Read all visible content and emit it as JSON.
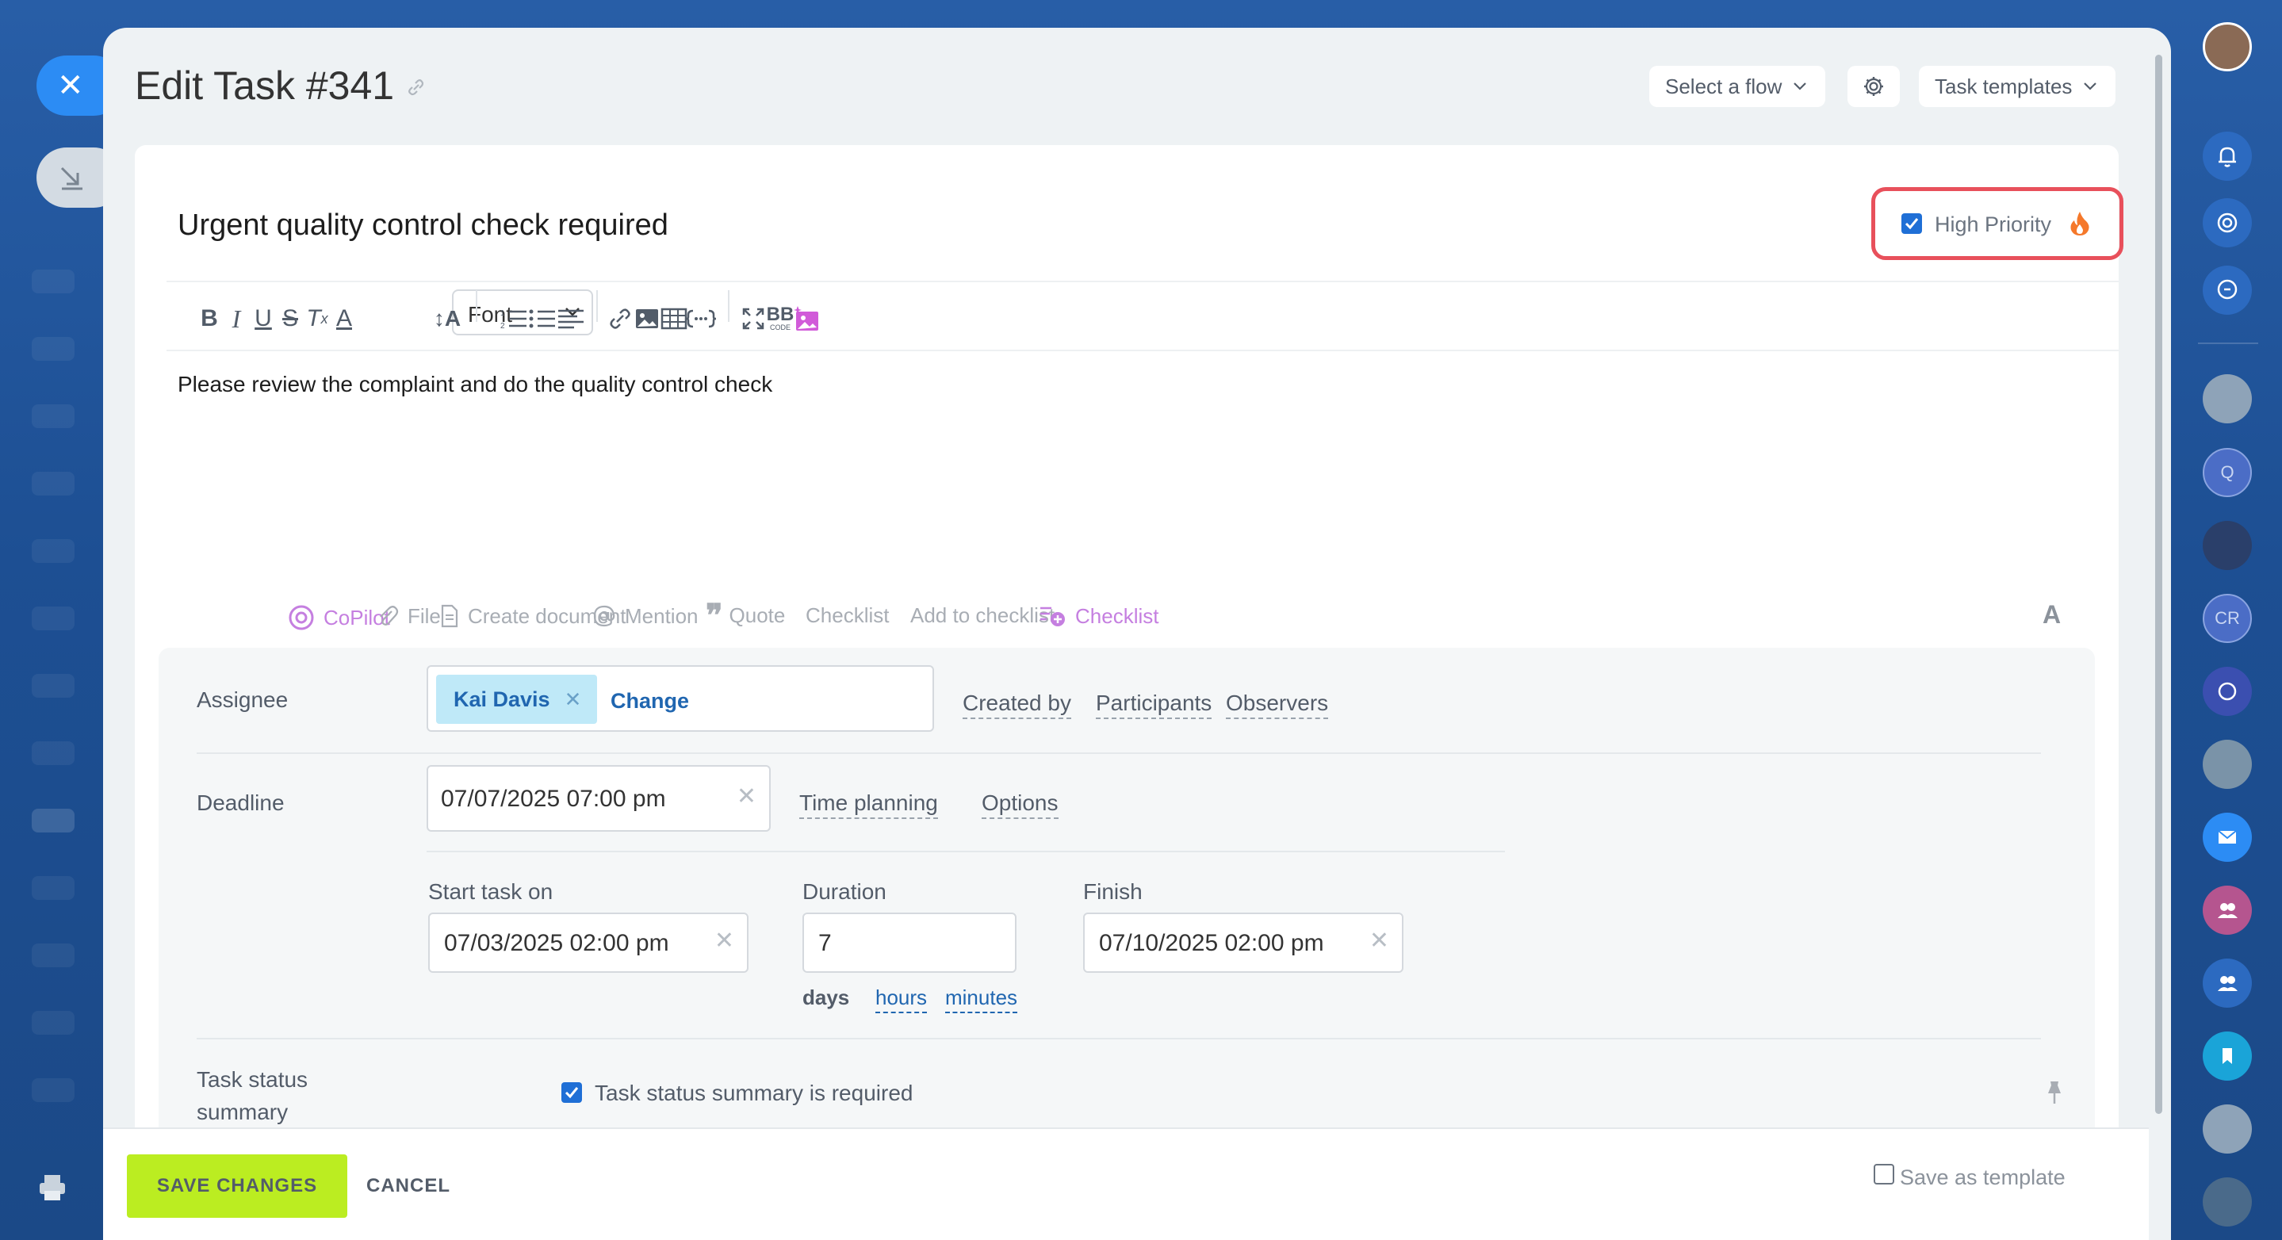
{
  "header": {
    "title": "Edit Task #341",
    "select_flow": "Select a flow",
    "task_templates": "Task templates"
  },
  "task": {
    "title": "Urgent quality control check required",
    "high_priority_label": "High Priority",
    "high_priority_checked": true,
    "description": "Please review the complaint and do the quality control check"
  },
  "toolbar": {
    "font_label": "Font",
    "buttons": [
      "bold",
      "italic",
      "underline",
      "strikethrough",
      "clear-format",
      "font-color",
      "font-size",
      "numbered-list",
      "bulleted-list",
      "align",
      "link",
      "image",
      "table",
      "code",
      "fullscreen",
      "bbcode",
      "ai-image"
    ]
  },
  "editor_tabs": {
    "copilot": "CoPilot",
    "file": "File",
    "create_document": "Create document",
    "mention": "Mention",
    "quote": "Quote",
    "checklist": "Checklist",
    "add_to_checklist": "Add to checklist",
    "checklist2": "Checklist",
    "format": "A"
  },
  "form": {
    "assignee_label": "Assignee",
    "assignee_name": "Kai Davis",
    "change": "Change",
    "created_by": "Created by",
    "participants": "Participants",
    "observers": "Observers",
    "deadline_label": "Deadline",
    "deadline_value": "07/07/2025 07:00 pm",
    "time_planning": "Time planning",
    "options": "Options",
    "start_label": "Start task on",
    "start_value": "07/03/2025 02:00 pm",
    "duration_label": "Duration",
    "duration_value": "7",
    "unit_days": "days",
    "unit_hours": "hours",
    "unit_minutes": "minutes",
    "finish_label": "Finish",
    "finish_value": "07/10/2025 02:00 pm",
    "status_label_line1": "Task status",
    "status_label_line2": "summary",
    "status_check_label": "Task status summary is required",
    "status_checked": true
  },
  "footer": {
    "save": "SAVE CHANGES",
    "cancel": "CANCEL",
    "save_template": "Save as template",
    "save_template_checked": false
  },
  "colors": {
    "accent": "#2066b0",
    "save_button": "#bbed21",
    "highlight_box": "#e8505b",
    "ai_purple": "#c57fe0"
  }
}
